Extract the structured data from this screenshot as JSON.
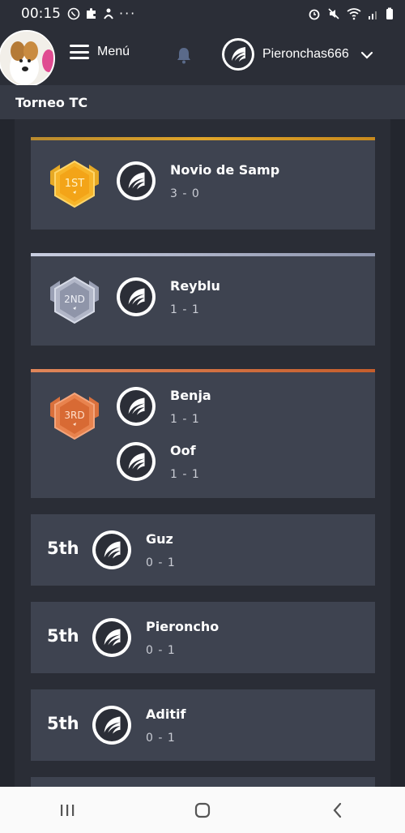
{
  "status_bar": {
    "time": "00:15"
  },
  "header": {
    "menu_label": "Menú",
    "username": "Pieronchas666"
  },
  "page": {
    "title": "Torneo TC"
  },
  "standings": [
    {
      "rank": "1ST",
      "teams": [
        {
          "name": "Novio de Samp",
          "score": "3 - 0"
        }
      ]
    },
    {
      "rank": "2ND",
      "teams": [
        {
          "name": "Reyblu",
          "score": "1 - 1"
        }
      ]
    },
    {
      "rank": "3RD",
      "teams": [
        {
          "name": "Benja",
          "score": "1 - 1"
        },
        {
          "name": "Oof",
          "score": "1 - 1"
        }
      ]
    },
    {
      "rank": "5th",
      "teams": [
        {
          "name": "Guz",
          "score": "0 - 1"
        }
      ]
    },
    {
      "rank": "5th",
      "teams": [
        {
          "name": "Pieroncho",
          "score": "0 - 1"
        }
      ]
    },
    {
      "rank": "5th",
      "teams": [
        {
          "name": "Aditif",
          "score": "0 - 1"
        }
      ]
    }
  ],
  "colors": {
    "gold": "#d99a22",
    "silver": "#9aa0b4",
    "bronze": "#d9703c",
    "card": "#3e4350"
  },
  "icons": {
    "menu": "hamburger-icon",
    "notifications": "bell-icon",
    "dropdown": "chevron-down-icon",
    "team": "wing-logo-icon",
    "nav_recent": "recent-apps-icon",
    "nav_home": "home-icon",
    "nav_back": "back-icon"
  }
}
